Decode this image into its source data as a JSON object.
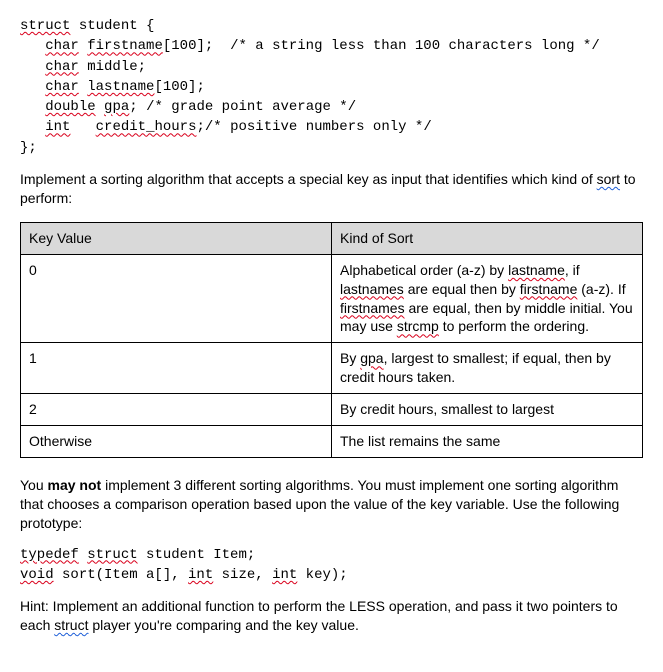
{
  "code1": {
    "l0_kw": "struct",
    "l0_rest": " student {",
    "l1_kw": "char",
    "l1_name": "firstname",
    "l1_rest": "[100];  /* a string less than 100 characters long */",
    "l2_kw": "char",
    "l2_rest": " middle;",
    "l3_kw": "char",
    "l3_name": "lastname",
    "l3_rest": "[100];",
    "l4_kw": "double",
    "l4_name": "gpa",
    "l4_rest": "; /* grade point average */",
    "l5_kw": "int",
    "l5_pad": "   ",
    "l5_name": "credit_hours",
    "l5_rest": ";/* positive numbers only */",
    "l6": "};"
  },
  "para1": {
    "before": "Implement a sorting algorithm that accepts a special key as input that identifies which kind of ",
    "u": "sort",
    "after": " to perform:"
  },
  "table": {
    "head": [
      "Key Value",
      "Kind of Sort"
    ],
    "rows": [
      {
        "key": "0",
        "parts": [
          {
            "t": "Alphabetical order (a-z) by "
          },
          {
            "t": "lastname",
            "cls": "red-wavy"
          },
          {
            "t": ", if "
          },
          {
            "t": "lastnames",
            "cls": "red-wavy"
          },
          {
            "t": " are equal then by "
          },
          {
            "t": "firstname",
            "cls": "red-wavy"
          },
          {
            "t": " (a-z). If "
          },
          {
            "t": "firstnames",
            "cls": "red-wavy"
          },
          {
            "t": " are equal, then by middle initial. You may use "
          },
          {
            "t": "strcmp",
            "cls": "red-wavy"
          },
          {
            "t": " to perform the ordering."
          }
        ]
      },
      {
        "key": "1",
        "parts": [
          {
            "t": "By "
          },
          {
            "t": "gpa",
            "cls": "red-wavy"
          },
          {
            "t": ", largest to smallest; if equal, then by credit hours taken."
          }
        ]
      },
      {
        "key": "2",
        "parts": [
          {
            "t": "By credit hours, smallest to largest"
          }
        ]
      },
      {
        "key": "Otherwise",
        "parts": [
          {
            "t": "The list remains the same"
          }
        ]
      }
    ]
  },
  "para2": {
    "before": "You ",
    "bold": "may not",
    "after": " implement 3 different sorting algorithms.  You must implement one sorting algorithm that chooses a comparison operation based upon the value of the key variable.  Use the following prototype:"
  },
  "code2": {
    "l0_kw1": "typedef",
    "l0_kw2": "struct",
    "l0_rest": " student Item;",
    "l1_kw1": "void",
    "l1_a": " sort(Item a[], ",
    "l1_kw2": "int",
    "l1_b": " size, ",
    "l1_kw3": "int",
    "l1_c": " key);"
  },
  "para3": {
    "before": "Hint: Implement an additional function to perform the LESS operation, and pass it two pointers to each ",
    "u": "struct",
    "after": " player you're comparing and the key value."
  }
}
